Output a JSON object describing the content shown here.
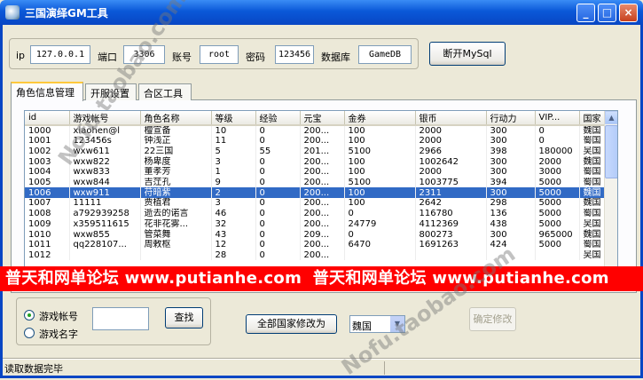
{
  "window": {
    "title": "三国演绎GM工具",
    "minimize": "_",
    "maximize": "□",
    "close": "×"
  },
  "connection": {
    "ip_label": "ip",
    "ip_value": "127.0.0.1",
    "port_label": "端口",
    "port_value": "3306",
    "user_label": "账号",
    "user_value": "root",
    "pass_label": "密码",
    "pass_value": "123456",
    "db_label": "数据库",
    "db_value": "GameDB",
    "disconnect_button": "断开MySql"
  },
  "tabs": [
    "角色信息管理",
    "开服设置",
    "合区工具"
  ],
  "table": {
    "columns": [
      "id",
      "游戏帐号",
      "角色名称",
      "等级",
      "经验",
      "元宝",
      "金券",
      "银币",
      "行动力",
      "VIP...",
      "国家"
    ],
    "rows": [
      [
        "1000",
        "xiaohen@l",
        "檀宣备",
        "10",
        "0",
        "200...",
        "100",
        "2000",
        "300",
        "0",
        "魏国"
      ],
      [
        "1001",
        "123456s",
        "钟浅芷",
        "11",
        "0",
        "200...",
        "100",
        "2000",
        "300",
        "0",
        "蜀国"
      ],
      [
        "1002",
        "wxw611",
        "22三国",
        "5",
        "55",
        "201...",
        "5100",
        "2966",
        "398",
        "180000",
        "吴国"
      ],
      [
        "1003",
        "wxw822",
        "杨卑度",
        "3",
        "0",
        "200...",
        "100",
        "1002642",
        "300",
        "2000",
        "魏国"
      ],
      [
        "1004",
        "wxw833",
        "董孝芳",
        "1",
        "0",
        "200...",
        "100",
        "2000",
        "300",
        "3000",
        "蜀国"
      ],
      [
        "1005",
        "wxw844",
        "吉茳孔",
        "9",
        "0",
        "200...",
        "5100",
        "1003775",
        "394",
        "5000",
        "蜀国"
      ],
      [
        "1006",
        "wxw911",
        "苻暗紫",
        "2",
        "0",
        "200...",
        "100",
        "2311",
        "300",
        "5000",
        "魏国"
      ],
      [
        "1007",
        "11111",
        "贾植君",
        "3",
        "0",
        "200...",
        "100",
        "2642",
        "298",
        "5000",
        "魏国"
      ],
      [
        "1008",
        "a792939258",
        "逝去的诺言",
        "46",
        "0",
        "200...",
        "0",
        "116780",
        "136",
        "5000",
        "蜀国"
      ],
      [
        "1009",
        "x359511615",
        "花非花雾...",
        "32",
        "0",
        "200...",
        "24779",
        "4112369",
        "438",
        "5000",
        "吴国"
      ],
      [
        "1010",
        "wxw855",
        "管菜舞",
        "43",
        "0",
        "209...",
        "0",
        "800273",
        "300",
        "965000",
        "魏国"
      ],
      [
        "1011",
        "qq228107...",
        "周敕枢",
        "12",
        "0",
        "200...",
        "6470",
        "1691263",
        "424",
        "5000",
        "蜀国"
      ],
      [
        "1012",
        "",
        "",
        "28",
        "0",
        "200...",
        "",
        "",
        "",
        "",
        "吴国"
      ]
    ],
    "selected_row": 6
  },
  "banner": {
    "text1": "普天和网单论坛 www.putianhe.com",
    "text2": "普天和网单论坛 www.putianhe.com"
  },
  "search": {
    "radio_account": "游戏帐号",
    "radio_name": "游戏名字",
    "search_value": "",
    "search_button": "查找",
    "change_all_button": "全部国家修改为",
    "country_selected": "魏国",
    "confirm_button": "确定修改"
  },
  "status": {
    "text": "读取数据完毕"
  },
  "watermarks": [
    "Nofu.taobao.com",
    "Nofu.taobao.com"
  ]
}
